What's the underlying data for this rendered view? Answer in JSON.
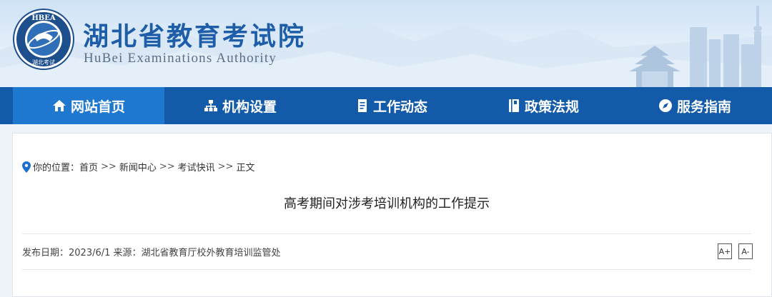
{
  "header": {
    "title": "湖北省教育考试院",
    "subtitle": "HuBei Examinations Authority",
    "logo": {
      "ring_text": "HBEA",
      "bottom_text": "湖北考试"
    }
  },
  "nav": {
    "items": [
      {
        "label": "网站首页",
        "icon": "home-icon",
        "active": true
      },
      {
        "label": "机构设置",
        "icon": "sitemap-icon",
        "active": false
      },
      {
        "label": "工作动态",
        "icon": "document-icon",
        "active": false
      },
      {
        "label": "政策法规",
        "icon": "book-icon",
        "active": false
      },
      {
        "label": "服务指南",
        "icon": "compass-icon",
        "active": false
      }
    ]
  },
  "breadcrumb": {
    "prefix": "你的位置：",
    "items": [
      "首页",
      "新闻中心",
      "考试快讯",
      "正文"
    ],
    "separator": ">>"
  },
  "article": {
    "title": "高考期间对涉考培训机构的工作提示",
    "meta": "发布日期：2023/6/1 来源：湖北省教育厅校外教育培训监管处",
    "font_increase": "A+",
    "font_decrease": "A-"
  },
  "colors": {
    "nav_bg": "#135aa8",
    "nav_active": "#1f78cf",
    "title_blue": "#1e5ea8",
    "pin_blue": "#1a6fd1"
  }
}
